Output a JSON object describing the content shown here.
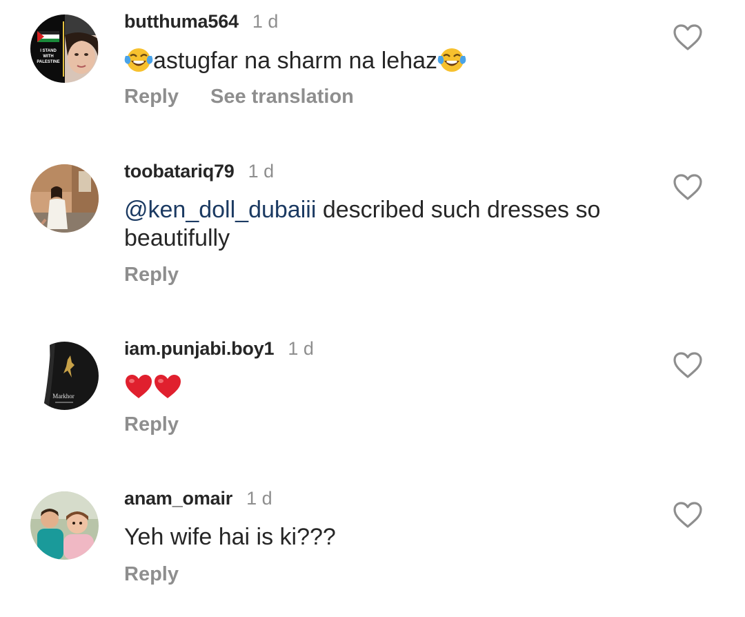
{
  "comments": [
    {
      "username": "butthuma564",
      "time": "1 d",
      "text_parts": [
        "astugfar na sharm na lehaz"
      ],
      "emojis": [
        "face-with-tears-of-joy",
        "face-with-tears-of-joy"
      ],
      "reply_label": "Reply",
      "translate_label": "See translation",
      "avatar_text": [
        "I STAND",
        "WITH",
        "PALESTINE"
      ]
    },
    {
      "username": "toobatariq79",
      "time": "1 d",
      "mention": "@ken_doll_dubaiii",
      "text_line1": " described such dresses so",
      "text_line2": "beautifully",
      "reply_label": "Reply"
    },
    {
      "username": "iam.punjabi.boy1",
      "time": "1 d",
      "emojis": [
        "red-heart",
        "red-heart"
      ],
      "reply_label": "Reply",
      "avatar_text": "Markhor"
    },
    {
      "username": "anam_omair",
      "time": "1 d",
      "text": "Yeh wife hai is ki???",
      "reply_label": "Reply"
    }
  ],
  "colors": {
    "text": "#262626",
    "secondary": "#8e8e8e",
    "mention": "#1b3a62",
    "heart_emoji": "#e0202e"
  },
  "icons": {
    "like": "heart-outline-icon"
  }
}
